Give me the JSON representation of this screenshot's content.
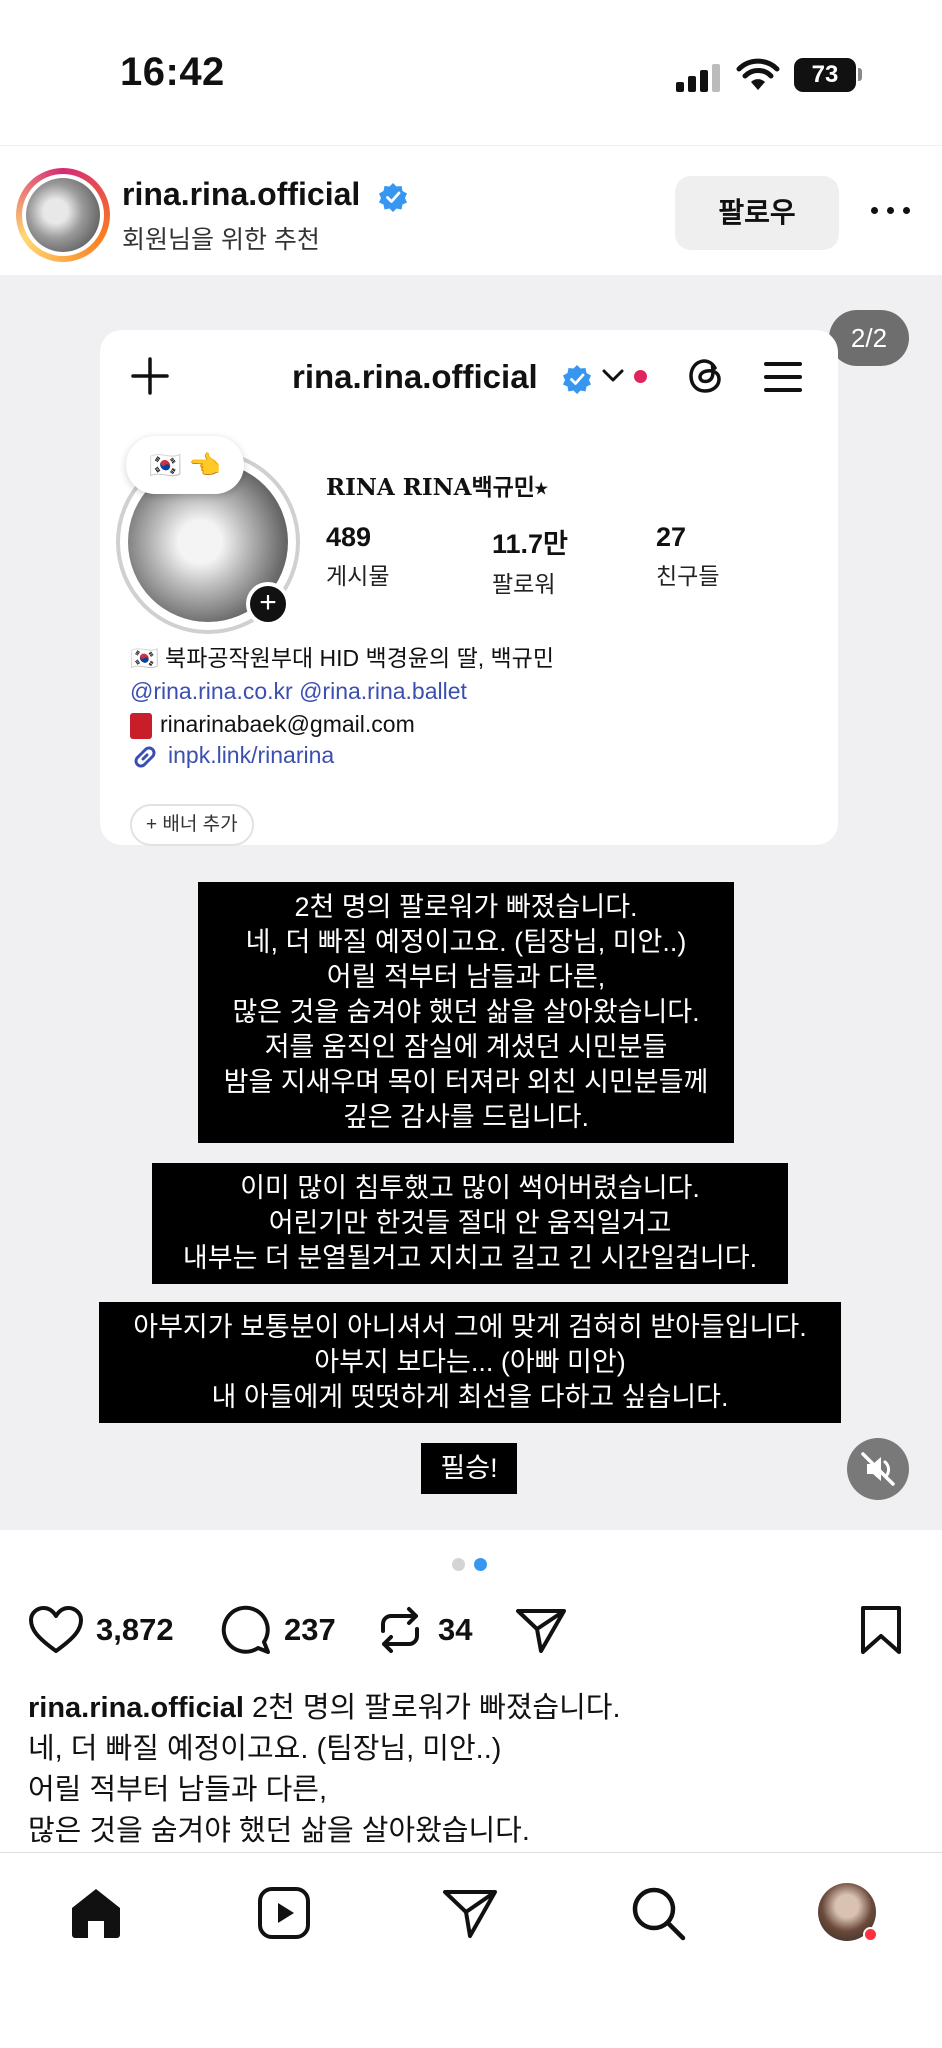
{
  "status_bar": {
    "time": "16:42",
    "battery": "73"
  },
  "post": {
    "username": "rina.rina.official",
    "subtitle": "회원님을 위한 추천",
    "follow_label": "팔로우",
    "slide_counter": "2/2"
  },
  "inner_profile": {
    "username": "rina.rina.official",
    "note": "🇰🇷 👈",
    "display_name": "RINA RINA백규민⭑",
    "stats": [
      {
        "value": "489",
        "label": "게시물"
      },
      {
        "value": "11.7만",
        "label": "팔로워"
      },
      {
        "value": "27",
        "label": "친구들"
      }
    ],
    "bio_line1": "🇰🇷 북파공작원부대 HID 백경윤의 딸, 백규민",
    "mention1": "@rina.rina.co.kr",
    "mention2": "@rina.rina.ballet",
    "email": "rinarinabaek@gmail.com",
    "link": "inpk.link/rinarina",
    "banner_label": "+ 배너 추가"
  },
  "story_text": {
    "block1": [
      "2천 명의 팔로워가 빠졌습니다.",
      "네, 더 빠질 예정이고요. (팀장님, 미안..)",
      "어릴 적부터 남들과 다른,",
      "많은 것을 숨겨야 했던 삶을 살아왔습니다.",
      "저를 움직인 잠실에 계셨던 시민분들",
      "밤을 지새우며 목이 터져라 외친 시민분들께",
      "깊은 감사를 드립니다."
    ],
    "block2": [
      "이미 많이 침투했고 많이 썩어버렸습니다.",
      "어린기만 한것들 절대 안 움직일거고",
      "내부는 더 분열될거고 지치고 길고 긴 시간일겁니다."
    ],
    "block3": [
      "아부지가 보통분이 아니셔서 그에 맞게 검혀히 받아들입니다.",
      "아부지 보다는... (아빠 미안)",
      "내 아들에게 떳떳하게 최선을 다하고 싶습니다."
    ],
    "block4": "필승!"
  },
  "actions": {
    "likes": "3,872",
    "comments": "237",
    "reposts": "34"
  },
  "caption": {
    "username": "rina.rina.official",
    "first_line": " 2천 명의 팔로워가 빠졌습니다.",
    "lines": [
      "네, 더 빠질 예정이고요. (팀장님, 미안..)",
      "어릴 적부터 남들과 다른,",
      "많은 것을 숨겨야 했던 삶을 살아왔습니다."
    ]
  },
  "colors": {
    "accent": "#3797f0",
    "verified": "#3797f0",
    "notification": "#ff3040"
  },
  "icons": [
    "home-icon",
    "reels-icon",
    "send-icon",
    "search-icon",
    "profile-icon"
  ]
}
